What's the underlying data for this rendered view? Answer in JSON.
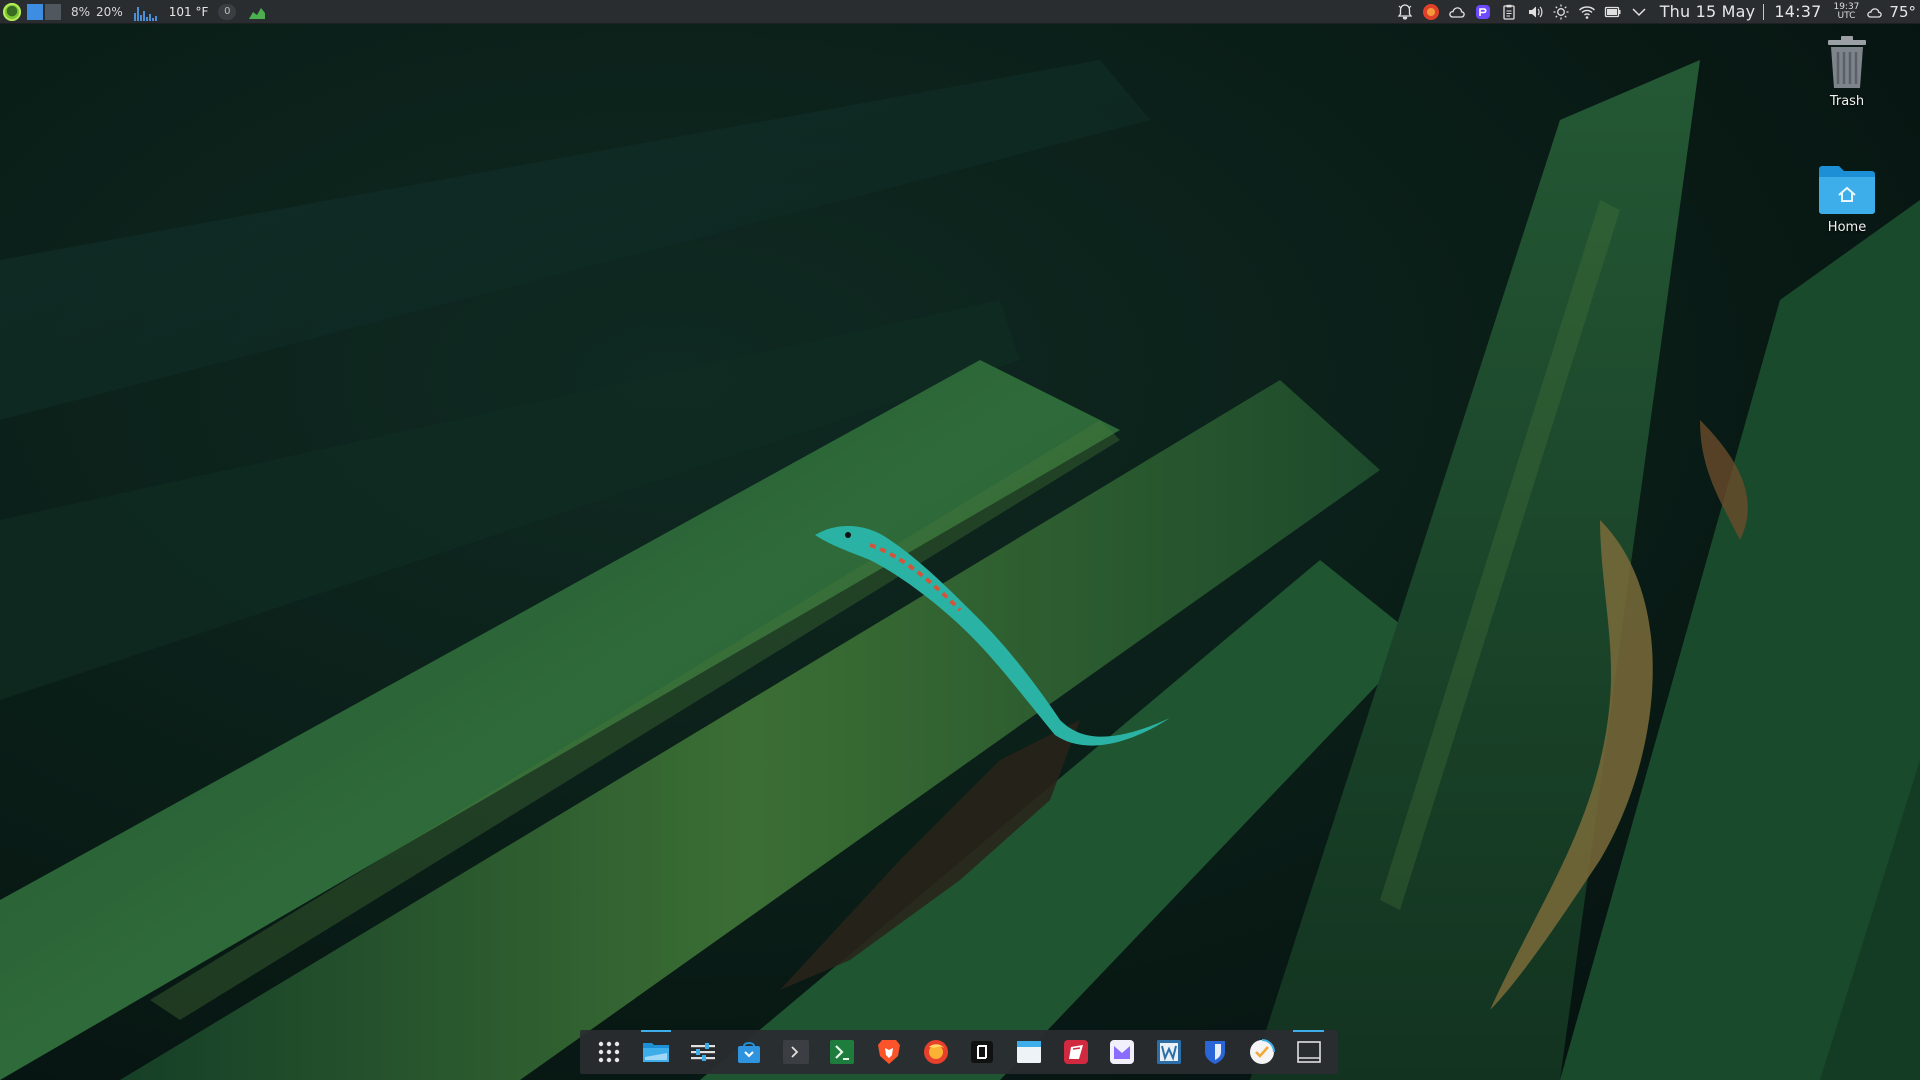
{
  "top_panel": {
    "cpu_percent": "8%",
    "ram_percent": "20%",
    "temperature": "101 °F",
    "counter": "0",
    "date": "Thu 15 May",
    "time": "14:37",
    "utc_time": "19:37",
    "utc_label": "UTC",
    "weather": "75°"
  },
  "desktop_icons": {
    "trash": {
      "label": "Trash",
      "icon": "trash-icon"
    },
    "home": {
      "label": "Home",
      "icon": "home-folder-icon"
    }
  },
  "dock": {
    "items": [
      "app-launcher-icon",
      "file-manager-icon",
      "settings-icon",
      "software-store-icon",
      "terminal-icon",
      "code-editor-icon",
      "brave-browser-icon",
      "firefox-icon",
      "notion-icon",
      "calendar-icon",
      "todo-icon",
      "proton-mail-icon",
      "word-processor-icon",
      "bitwarden-icon",
      "tasks-icon",
      "show-desktop-icon"
    ]
  },
  "colors": {
    "panel_bg": "#2a2d30",
    "accent": "#3daee9",
    "leaf_green": "#1f5a35"
  }
}
